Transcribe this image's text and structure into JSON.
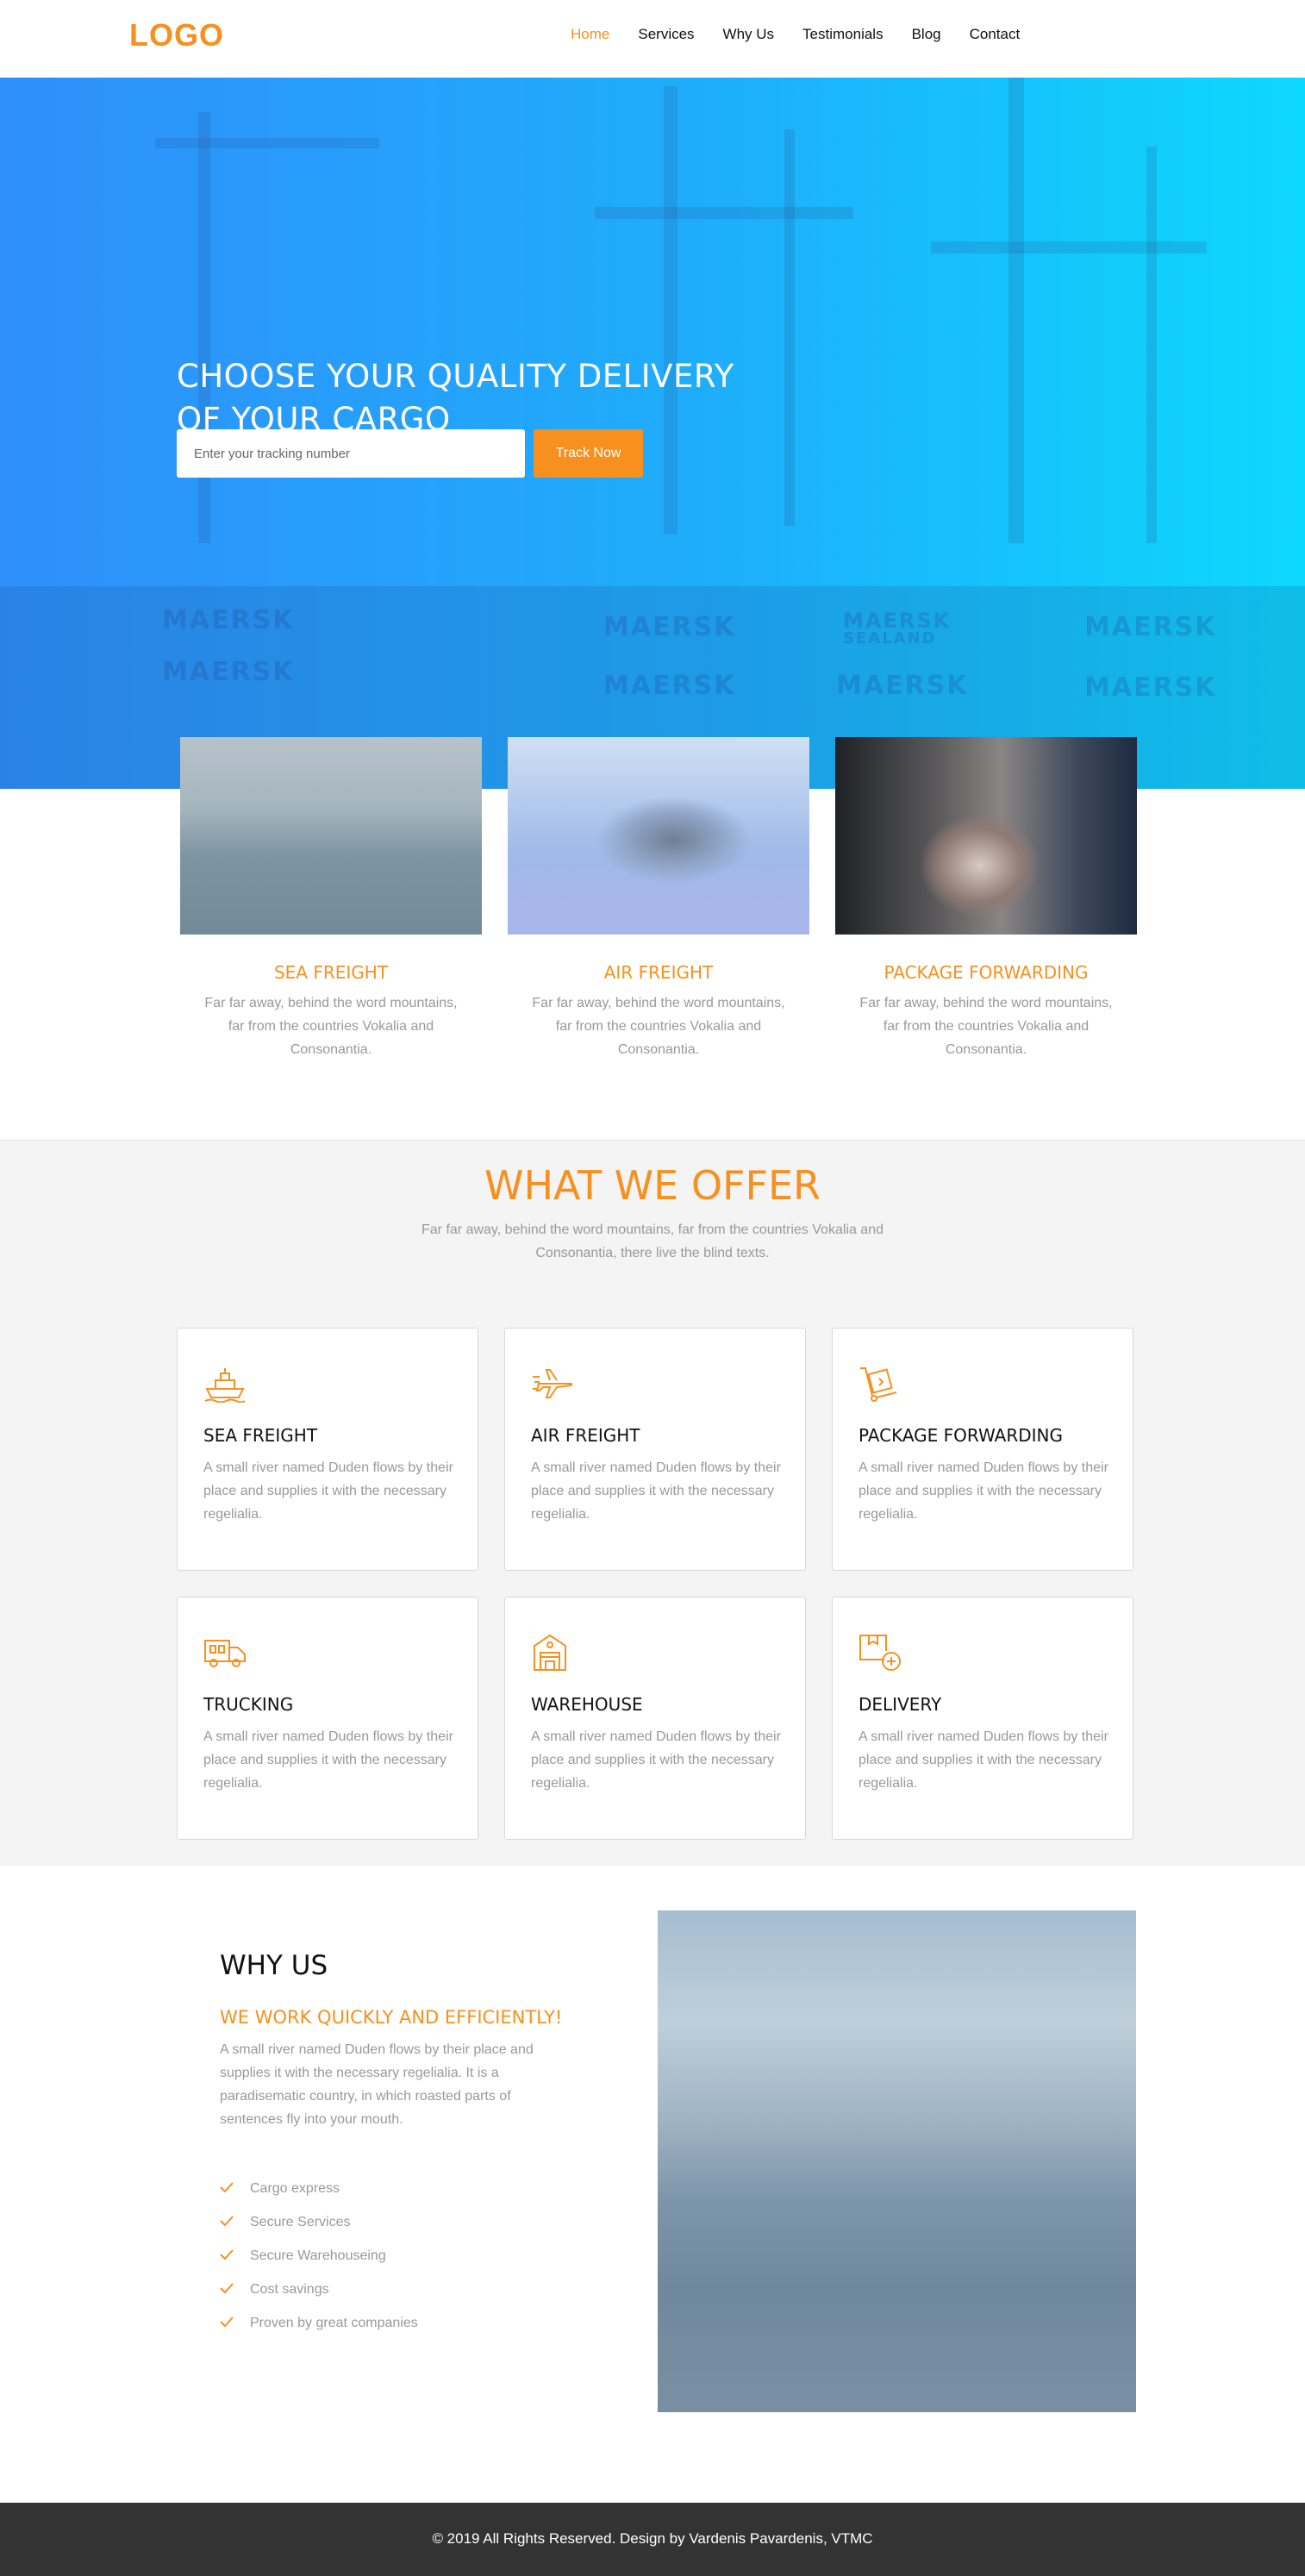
{
  "header": {
    "logo": "LOGO",
    "nav": [
      "Home",
      "Services",
      "Why Us",
      "Testimonials",
      "Blog",
      "Contact"
    ],
    "active": "Home"
  },
  "hero": {
    "title_line1": "CHOOSE YOUR QUALITY DELIVERY",
    "title_line2": "OF YOUR CARGO",
    "tracking_placeholder": "Enter your tracking number",
    "track_button": "Track Now",
    "background_text": [
      "MAERSK",
      "MAERSK",
      "MAERSK",
      "MAERSK",
      "MAERSK",
      "MAERSK",
      "MAERSK",
      "MAERSK",
      "SEALAND"
    ]
  },
  "features": [
    {
      "title": "SEA FREIGHT",
      "text": "Far far away, behind the word mountains, far from the countries Vokalia and Consonantia."
    },
    {
      "title": "AIR FREIGHT",
      "text": "Far far away, behind the word mountains, far from the countries Vokalia and Consonantia."
    },
    {
      "title": "PACKAGE FORWARDING",
      "text": "Far far away, behind the word mountains, far from the countries Vokalia and Consonantia."
    }
  ],
  "offer": {
    "title": "WHAT WE OFFER",
    "subtitle": "Far far away, behind the word mountains, far from the countries Vokalia and Consonantia, there live the blind texts.",
    "cards": [
      {
        "icon": "cargo-ship-icon",
        "title": "SEA FREIGHT",
        "text": "A small river named Duden flows by their place and supplies it with the necessary regelialia."
      },
      {
        "icon": "airplane-icon",
        "title": "AIR FREIGHT",
        "text": "A small river named Duden flows by their place and supplies it with the necessary regelialia."
      },
      {
        "icon": "hand-truck-icon",
        "title": "PACKAGE FORWARDING",
        "text": "A small river named Duden flows by their place and supplies it with the necessary regelialia."
      },
      {
        "icon": "truck-icon",
        "title": "TRUCKING",
        "text": "A small river named Duden flows by their place and supplies it with the necessary regelialia."
      },
      {
        "icon": "warehouse-icon",
        "title": "WAREHOUSE",
        "text": "A small river named Duden flows by their place and supplies it with the necessary regelialia."
      },
      {
        "icon": "delivery-box-icon",
        "title": "DELIVERY",
        "text": "A small river named Duden flows by their place and supplies it with the necessary regelialia."
      }
    ]
  },
  "why": {
    "title": "WHY US",
    "subtitle": "WE WORK QUICKLY AND EFFICIENTLY!",
    "text": "A small river named Duden flows by their place and supplies it with the necessary regelialia. It is a paradisematic country, in which roasted parts of sentences fly into your mouth.",
    "items": [
      "Cargo express",
      "Secure Services",
      "Secure Warehouseing",
      "Cost savings",
      "Proven by great companies"
    ]
  },
  "footer": {
    "text": "© 2019  All Rights Reserved. Design by Vardenis Pavardenis, VTMC"
  },
  "colors": {
    "accent": "#f7901e",
    "hero_start": "#2f8ffb",
    "hero_end": "#0dd8fd",
    "footer": "#333333"
  }
}
